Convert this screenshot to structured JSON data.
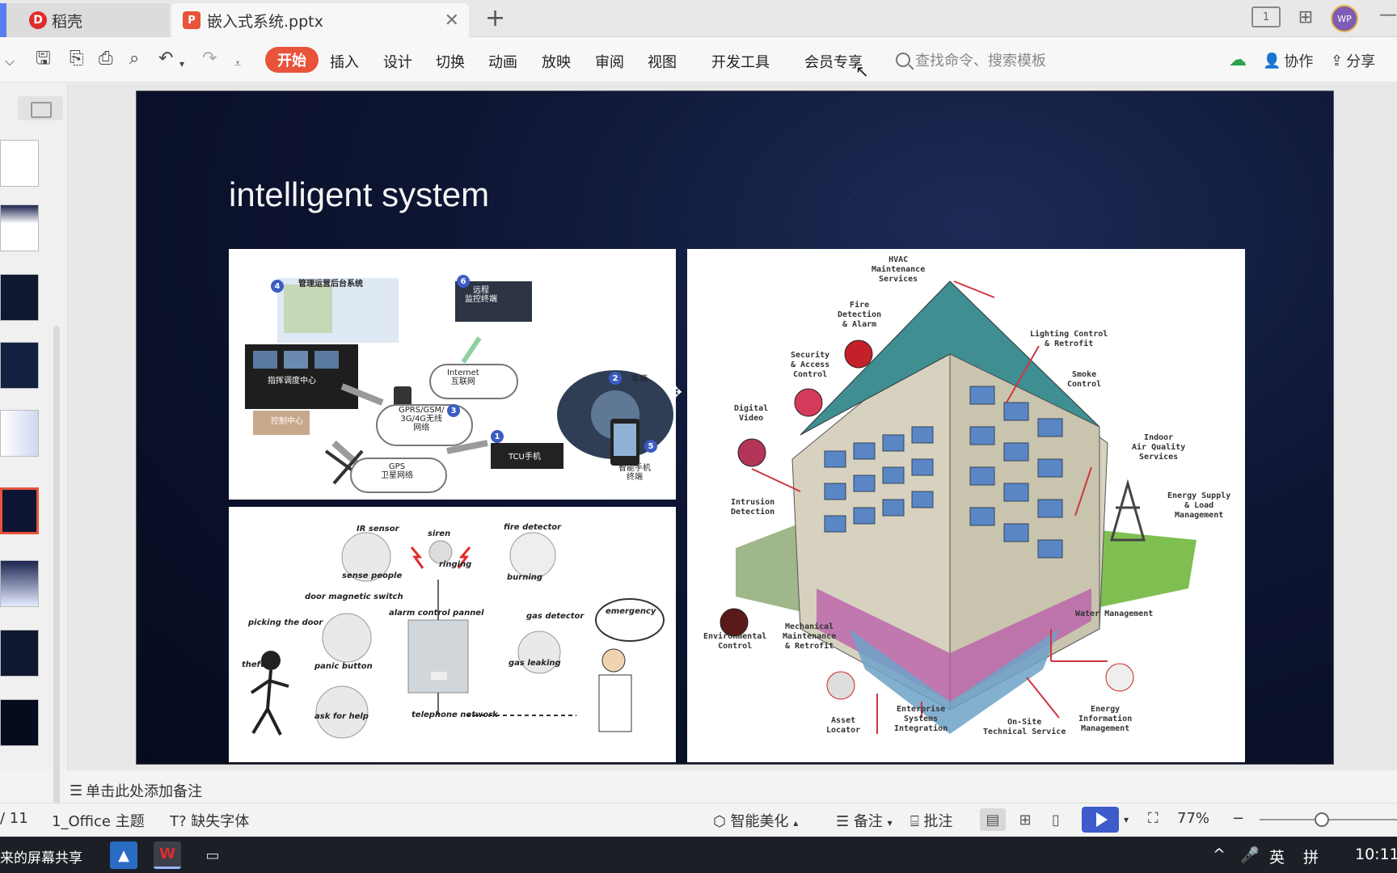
{
  "titlebar": {
    "tabs": [
      {
        "label": "稻壳",
        "icon": "docer-logo-icon"
      },
      {
        "label": "嵌入式系统.pptx",
        "icon": "pptx-file-icon"
      }
    ],
    "layout_badge": "1",
    "avatar": "WP"
  },
  "ribbon": {
    "menus": [
      "开始",
      "插入",
      "设计",
      "切换",
      "动画",
      "放映",
      "审阅",
      "视图",
      "开发工具",
      "会员专享"
    ],
    "search_placeholder": "查找命令、搜索模板",
    "collaborate": "协作",
    "share": "分享"
  },
  "slide": {
    "title": "intelligent system",
    "top_left": {
      "labels": {
        "backend": "管理运营后台系统",
        "remote": "远程\n监控终端",
        "dispatch": "指挥调度中心",
        "center2": "控制中心",
        "internet": "Internet\n互联网",
        "gprs": "GPRS/GSM/\n3G/4G无线\n网络",
        "gps": "GPS\n卫星网络",
        "tcu": "TCU手机",
        "mobile": "智能手机\n终端",
        "car": "车辆",
        "n1": "1",
        "n2": "2",
        "n3": "3",
        "n4": "4",
        "n5": "5",
        "n6": "6"
      }
    },
    "bottom_left": {
      "labels": {
        "ir_sensor": "IR sensor",
        "siren": "siren",
        "fire_detector": "fire detector",
        "sense_people": "sense people",
        "ringing": "ringing",
        "burning": "burning",
        "door_switch": "door magnetic switch",
        "alarm_panel": "alarm control pannel",
        "gas_detector": "gas detector",
        "emergency": "emergency",
        "picking_door": "picking the door",
        "theft": "theft",
        "panic_button": "panic button",
        "gas_leaking": "gas leaking",
        "ask_help": "ask for help",
        "telephone": "telephone network"
      }
    },
    "right": {
      "labels": {
        "hvac": "HVAC\nMaintenance\nServices",
        "fire": "Fire\nDetection\n& Alarm",
        "security": "Security\n& Access\nControl",
        "lighting": "Lighting Control\n& Retrofit",
        "smoke": "Smoke\nControl",
        "digital_video": "Digital\nVideo",
        "indoor_air": "Indoor\nAir Quality\nServices",
        "intrusion": "Intrusion\nDetection",
        "energy_supply": "Energy Supply\n& Load\nManagement",
        "water": "Water Management",
        "environmental": "Environmental\nControl",
        "mechanical": "Mechanical\nMaintenance\n& Retrofit",
        "asset": "Asset\nLocator",
        "enterprise": "Enterprise\nSystems\nIntegration",
        "onsite": "On-Site\nTechnical Service",
        "energy_info": "Energy\nInformation\nManagement"
      }
    }
  },
  "notes_placeholder": "单击此处添加备注",
  "status": {
    "page": "/ 11",
    "theme": "1_Office 主题",
    "missing_font": "缺失字体",
    "beautify": "智能美化",
    "notes": "备注",
    "comments": "批注",
    "zoom": "77%"
  },
  "taskbar": {
    "share_text": "来的屏幕共享",
    "ime_lang": "英",
    "ime_mode": "拼",
    "time": "10:11"
  },
  "colors": {
    "accent": "#e8533a",
    "play": "#3d5cc9"
  }
}
